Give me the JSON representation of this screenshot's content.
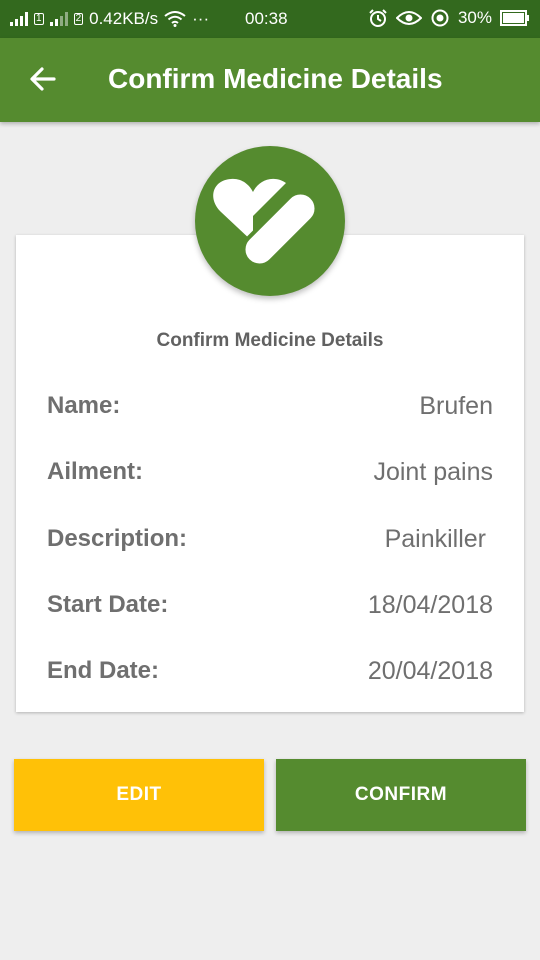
{
  "status_bar": {
    "network_speed": "0.42KB/s",
    "sim_label": "2",
    "more": "···",
    "time": "00:38",
    "battery": "30%"
  },
  "app_bar": {
    "title": "Confirm Medicine Details",
    "back_icon": "arrow-back-icon"
  },
  "logo": {
    "icon": "heart-pill-icon"
  },
  "card": {
    "title": "Confirm Medicine Details",
    "rows": [
      {
        "label": "Name:",
        "value": "Brufen"
      },
      {
        "label": "Ailment:",
        "value": "Joint pains"
      },
      {
        "label": "Description:",
        "value": "Painkiller"
      },
      {
        "label": "Start Date:",
        "value": "18/04/2018"
      },
      {
        "label": "End Date:",
        "value": "20/04/2018"
      }
    ]
  },
  "buttons": {
    "edit": "EDIT",
    "confirm": "CONFIRM"
  },
  "colors": {
    "status_bar": "#33691e",
    "primary": "#558b2f",
    "edit_button": "#ffc107",
    "background": "#eeeeee"
  }
}
